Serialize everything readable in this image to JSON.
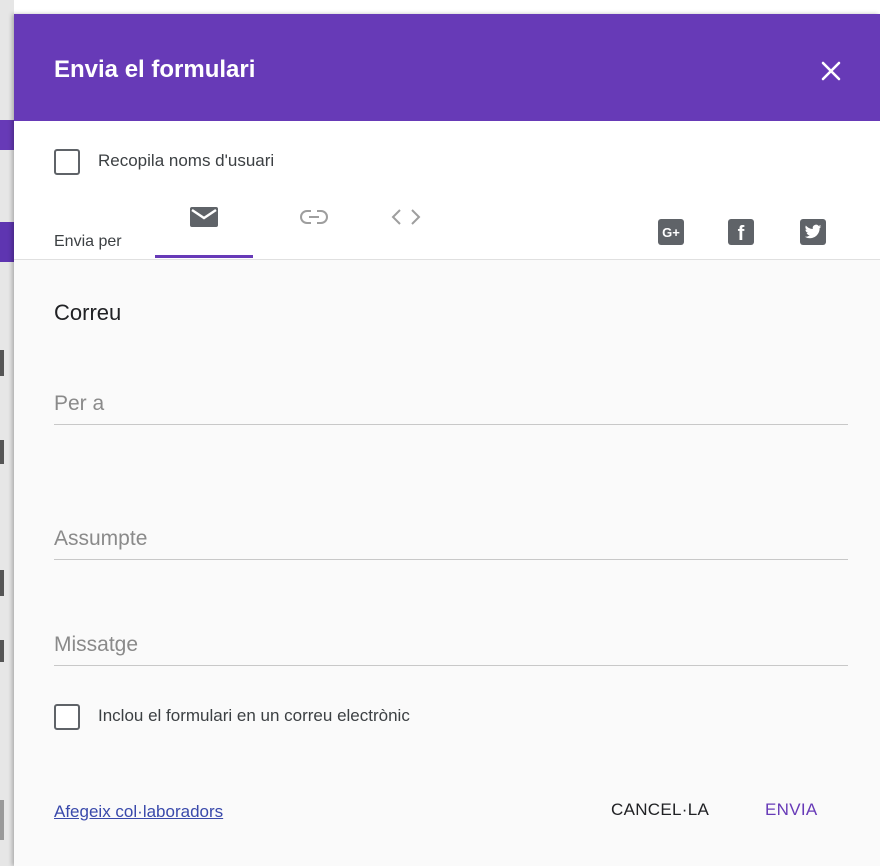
{
  "dialog": {
    "title": "Envia el formulari"
  },
  "options": {
    "collect_usernames_label": "Recopila noms d'usuari",
    "collect_usernames_checked": false
  },
  "send_via": {
    "label": "Envia per",
    "tabs": [
      {
        "icon": "email-icon",
        "selected": true
      },
      {
        "icon": "link-icon",
        "selected": false
      },
      {
        "icon": "embed-code-icon",
        "selected": false
      }
    ],
    "social": [
      {
        "icon": "google-plus-icon",
        "text": "G+"
      },
      {
        "icon": "facebook-icon",
        "text": "f"
      },
      {
        "icon": "twitter-icon"
      }
    ]
  },
  "email": {
    "section_title": "Correu",
    "to_placeholder": "Per a",
    "subject_placeholder": "Assumpte",
    "message_placeholder": "Missatge",
    "include_form_label": "Inclou el formulari en un correu electrònic",
    "include_form_checked": false
  },
  "footer": {
    "add_collaborators_label": "Afegeix col·laboradors",
    "cancel_label": "CANCEL·LA",
    "send_label": "ENVIA"
  },
  "colors": {
    "accent": "#673ab7",
    "link": "#3949ab",
    "icon_grey": "#5f6368"
  }
}
